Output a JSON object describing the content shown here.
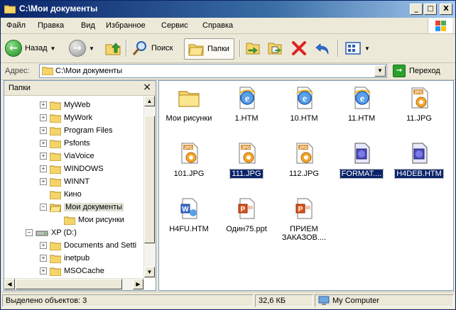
{
  "window": {
    "title": "C:\\Мои документы"
  },
  "titlebar_buttons": {
    "minimize": "_",
    "maximize": "□",
    "close": "X"
  },
  "menu": {
    "items": [
      "Файл",
      "Правка",
      "Вид",
      "Избранное",
      "Сервис",
      "Справка"
    ]
  },
  "toolbar": {
    "back": "Назад",
    "search": "Поиск",
    "folders": "Папки"
  },
  "address": {
    "label": "Адрес:",
    "value": "C:\\Мои документы",
    "go": "Переход"
  },
  "folder_pane": {
    "title": "Папки",
    "close": "×",
    "tree": [
      {
        "label": "MyWeb",
        "level": 2,
        "expander": "+"
      },
      {
        "label": "MyWork",
        "level": 2,
        "expander": "+"
      },
      {
        "label": "Program Files",
        "level": 2,
        "expander": "+"
      },
      {
        "label": "Psfonts",
        "level": 2,
        "expander": "+"
      },
      {
        "label": "ViaVoice",
        "level": 2,
        "expander": "+"
      },
      {
        "label": "WINDOWS",
        "level": 2,
        "expander": "+"
      },
      {
        "label": "WINNT",
        "level": 2,
        "expander": "+"
      },
      {
        "label": "Кино",
        "level": 2,
        "expander": ""
      },
      {
        "label": "Мои документы",
        "level": 2,
        "expander": "−",
        "selected": true
      },
      {
        "label": "Мои рисунки",
        "level": 3,
        "expander": ""
      },
      {
        "label": "XP (D:)",
        "level": 1,
        "expander": "−",
        "drive": true
      },
      {
        "label": "Documents and Setti",
        "level": 2,
        "expander": "+"
      },
      {
        "label": "inetpub",
        "level": 2,
        "expander": "+"
      },
      {
        "label": "MSOCache",
        "level": 2,
        "expander": "+"
      }
    ]
  },
  "files": [
    {
      "name": "Мои рисунки",
      "type": "folder",
      "selected": false
    },
    {
      "name": "1.HTM",
      "type": "htm",
      "selected": false
    },
    {
      "name": "10.HTM",
      "type": "htm",
      "selected": false
    },
    {
      "name": "11.HTM",
      "type": "htm",
      "selected": false
    },
    {
      "name": "11.JPG",
      "type": "jpg",
      "selected": false
    },
    {
      "name": "101.JPG",
      "type": "jpg",
      "selected": false
    },
    {
      "name": "111.JPG",
      "type": "jpg",
      "selected": true
    },
    {
      "name": "112.JPG",
      "type": "jpg",
      "selected": false
    },
    {
      "name": "FORMAT....",
      "type": "web",
      "selected": true
    },
    {
      "name": "H4DEB.HTM",
      "type": "web",
      "selected": true
    },
    {
      "name": "H4FU.HTM",
      "type": "htmlword",
      "selected": false
    },
    {
      "name": "Один75.ppt",
      "type": "ppt",
      "selected": false
    },
    {
      "name": "ПРИЕМ\nЗАКАЗОВ....",
      "type": "ppt",
      "selected": false
    }
  ],
  "status": {
    "selected": "Выделено объектов: 3",
    "size": "32,6 КБ",
    "location": "My Computer"
  },
  "colors": {
    "selection": "#0a246a",
    "title_start": "#0a246a",
    "window_bg": "#ece9d8"
  }
}
